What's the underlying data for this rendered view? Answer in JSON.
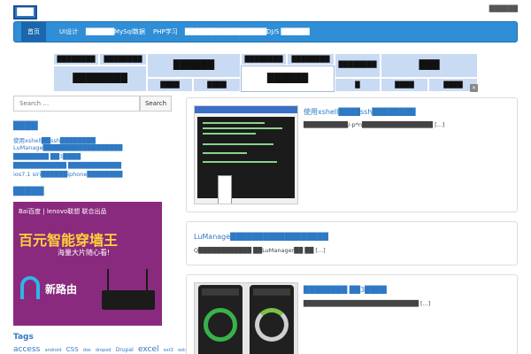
{
  "header": {
    "logo": "███",
    "top_right": "██████"
  },
  "nav": {
    "items": [
      "首页",
      "UI设计",
      "██████",
      "MySql数据",
      "PHP学习",
      "██████",
      "██████",
      "██████",
      "DJ/S ██████"
    ]
  },
  "tiles": {
    "a": "████████",
    "b": "████████",
    "c": "████████",
    "d": "██████",
    "e": "██████",
    "f": "████",
    "g": "████",
    "h": "████████",
    "i": "████████",
    "j": "████████",
    "k": "█",
    "l": "████",
    "m": "████",
    "n": "███"
  },
  "search": {
    "placeholder": "Search …",
    "button": "Search"
  },
  "sidebar": {
    "recent_title": "████",
    "recent": [
      "使用xshell██ssh████████",
      "LuManage██████████████████",
      "████████ ██3████",
      "████████████ ████████████",
      "ios7.1 siri██████iphone████████"
    ],
    "ad_title": "█████",
    "ad": {
      "brands": "Bai百度 | lenovo联想  联合出品",
      "headline": "百元智能穿墙王",
      "sub": "海量大片随心看!",
      "product": "新路由"
    },
    "tags_title": "Tags",
    "tags": [
      "access",
      "android",
      "CSS",
      "dos",
      "dropod",
      "Drupal",
      "excel",
      "ext3",
      "ext4"
    ]
  },
  "posts": [
    {
      "title": "使用xshell████ssh████████",
      "excerpt": "██████████/-p*n████████████████ [...]"
    },
    {
      "title": "LuManage██████████████████",
      "excerpt": "Q████████████ ██LuManager██ ██ [...]"
    },
    {
      "title": "████████ ██3████",
      "excerpt": "██████████████████████████ [...]"
    }
  ],
  "phone": {
    "left_speed": "0.1",
    "right_value": "45"
  }
}
